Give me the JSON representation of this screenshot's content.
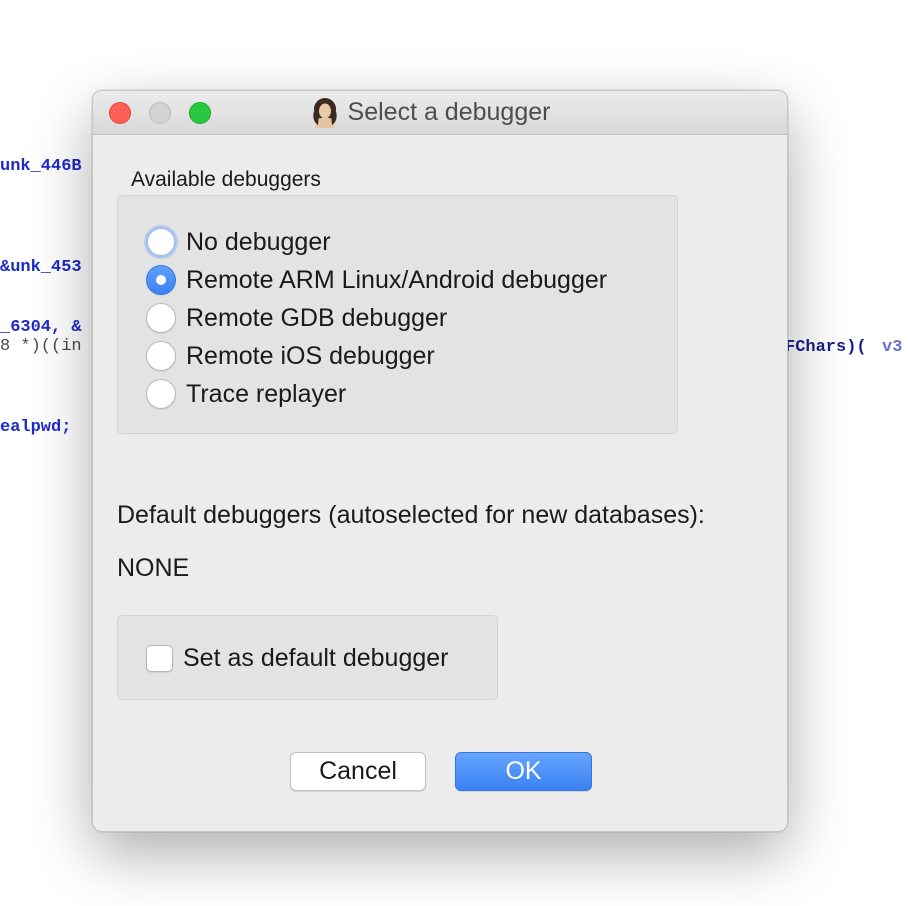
{
  "background_code": {
    "line1": "unk_446B",
    "line2": "&unk_453",
    "line3a": "_6304, &",
    "line3b": "8 *)((in",
    "line3c": "FChars)(",
    "line3d": "v3",
    "line4": "ealpwd;"
  },
  "dialog": {
    "title": "Select a debugger",
    "available_label": "Available debuggers",
    "debuggers": [
      {
        "label": "No debugger",
        "selected": false
      },
      {
        "label": "Remote ARM Linux/Android debugger",
        "selected": true
      },
      {
        "label": "Remote GDB debugger",
        "selected": false
      },
      {
        "label": "Remote iOS debugger",
        "selected": false
      },
      {
        "label": "Trace replayer",
        "selected": false
      }
    ],
    "default_heading": "Default debuggers (autoselected for new databases):",
    "default_value": "NONE",
    "set_default_label": "Set as default debugger",
    "set_default_checked": false,
    "cancel_label": "Cancel",
    "ok_label": "OK"
  },
  "colors": {
    "accent": "#3b80f0",
    "close": "#fe5f57",
    "zoom": "#28c840",
    "code_blue": "#1e2bc8"
  }
}
